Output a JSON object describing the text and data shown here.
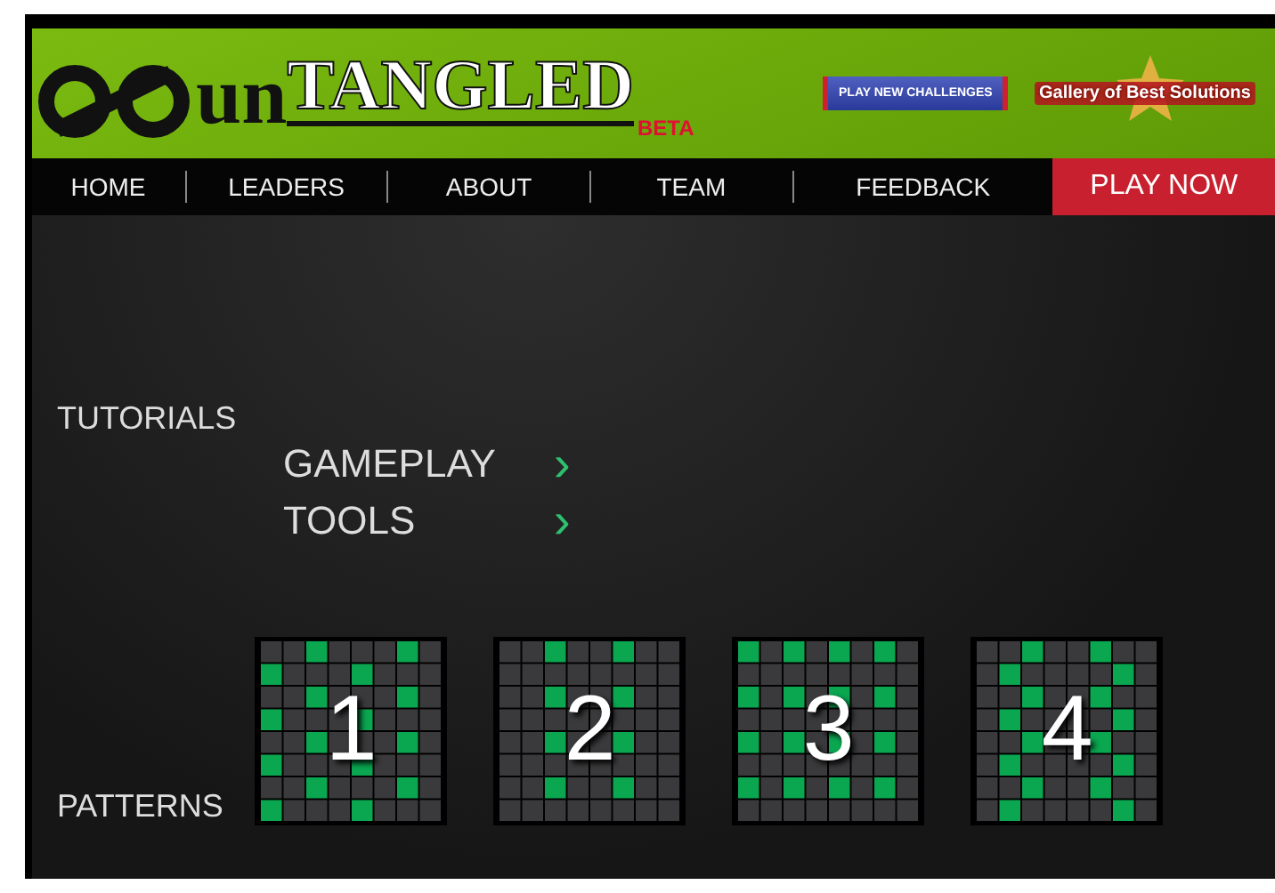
{
  "header": {
    "logo_prefix": "un",
    "logo_main": "TANGLED",
    "logo_badge": "BETA",
    "challenges_button": "PLAY NEW CHALLENGES",
    "gallery_link": "Gallery of Best Solutions"
  },
  "nav": {
    "items": [
      {
        "label": "HOME"
      },
      {
        "label": "LEADERS"
      },
      {
        "label": "ABOUT"
      },
      {
        "label": "TEAM"
      },
      {
        "label": "FEEDBACK"
      }
    ],
    "play_button": "PLAY NOW"
  },
  "tutorials": {
    "heading": "TUTORIALS",
    "links": [
      {
        "label": "GAMEPLAY",
        "arrow": "›"
      },
      {
        "label": "TOOLS",
        "arrow": "›"
      }
    ]
  },
  "patterns": {
    "heading": "PATTERNS",
    "items": [
      {
        "label": "1",
        "grid": [
          [
            false,
            false,
            true,
            false,
            false,
            false,
            true,
            false
          ],
          [
            true,
            false,
            false,
            false,
            true,
            false,
            false,
            false
          ],
          [
            false,
            false,
            true,
            false,
            false,
            false,
            true,
            false
          ],
          [
            true,
            false,
            false,
            false,
            true,
            false,
            false,
            false
          ],
          [
            false,
            false,
            true,
            false,
            false,
            false,
            true,
            false
          ],
          [
            true,
            false,
            false,
            false,
            true,
            false,
            false,
            false
          ],
          [
            false,
            false,
            true,
            false,
            false,
            false,
            true,
            false
          ],
          [
            true,
            false,
            false,
            false,
            true,
            false,
            false,
            false
          ]
        ]
      },
      {
        "label": "2",
        "grid": [
          [
            false,
            false,
            true,
            false,
            false,
            true,
            false,
            false
          ],
          [
            false,
            false,
            false,
            false,
            false,
            false,
            false,
            false
          ],
          [
            false,
            false,
            true,
            false,
            false,
            true,
            false,
            false
          ],
          [
            false,
            false,
            false,
            false,
            false,
            false,
            false,
            false
          ],
          [
            false,
            false,
            true,
            false,
            false,
            true,
            false,
            false
          ],
          [
            false,
            false,
            false,
            false,
            false,
            false,
            false,
            false
          ],
          [
            false,
            false,
            true,
            false,
            false,
            true,
            false,
            false
          ],
          [
            false,
            false,
            false,
            false,
            false,
            false,
            false,
            false
          ]
        ]
      },
      {
        "label": "3",
        "grid": [
          [
            true,
            false,
            true,
            false,
            true,
            false,
            true,
            false
          ],
          [
            false,
            false,
            false,
            false,
            false,
            false,
            false,
            false
          ],
          [
            true,
            false,
            true,
            false,
            true,
            false,
            true,
            false
          ],
          [
            false,
            false,
            false,
            false,
            false,
            false,
            false,
            false
          ],
          [
            true,
            false,
            true,
            false,
            true,
            false,
            true,
            false
          ],
          [
            false,
            false,
            false,
            false,
            false,
            false,
            false,
            false
          ],
          [
            true,
            false,
            true,
            false,
            true,
            false,
            true,
            false
          ],
          [
            false,
            false,
            false,
            false,
            false,
            false,
            false,
            false
          ]
        ]
      },
      {
        "label": "4",
        "grid": [
          [
            false,
            false,
            true,
            false,
            false,
            true,
            false,
            false
          ],
          [
            false,
            true,
            false,
            false,
            false,
            false,
            true,
            false
          ],
          [
            false,
            false,
            true,
            false,
            false,
            true,
            false,
            false
          ],
          [
            false,
            true,
            false,
            false,
            false,
            false,
            true,
            false
          ],
          [
            false,
            false,
            true,
            false,
            false,
            true,
            false,
            false
          ],
          [
            false,
            true,
            false,
            false,
            false,
            false,
            true,
            false
          ],
          [
            false,
            false,
            true,
            false,
            false,
            true,
            false,
            false
          ],
          [
            false,
            true,
            false,
            false,
            false,
            false,
            true,
            false
          ]
        ]
      }
    ]
  }
}
